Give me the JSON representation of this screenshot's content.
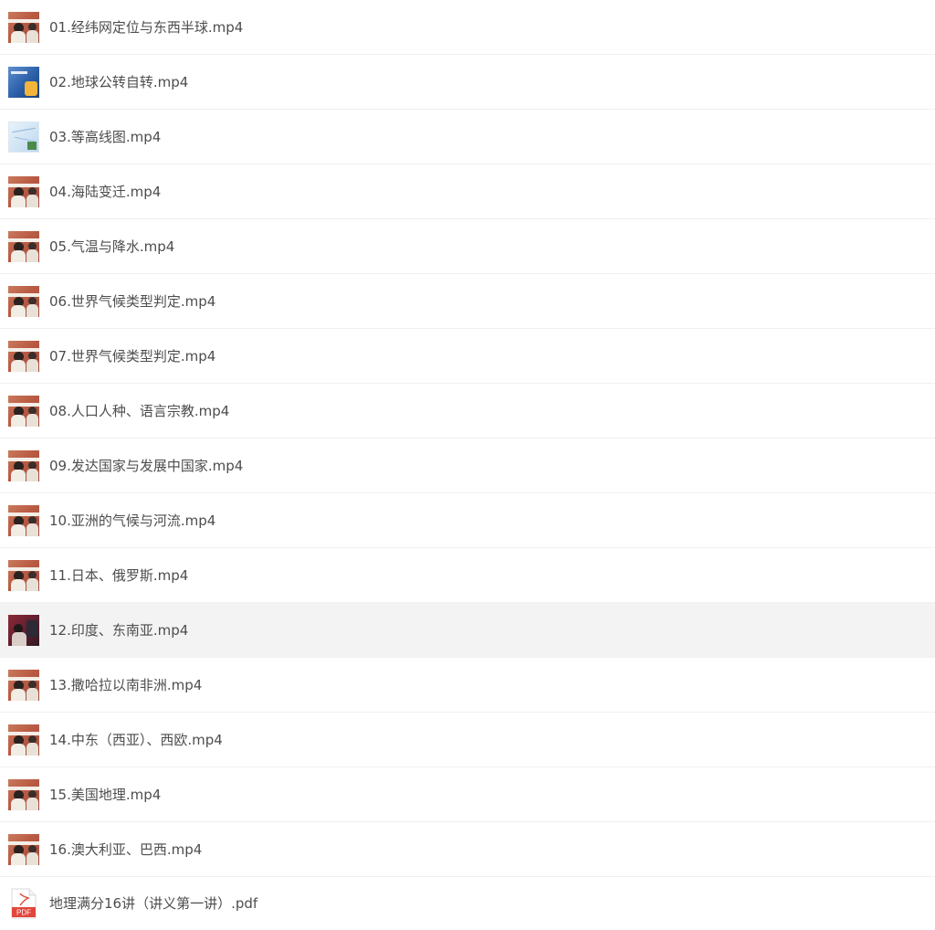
{
  "files": [
    {
      "name": "01.经纬网定位与东西半球.mp4",
      "type": "video"
    },
    {
      "name": "02.地球公转自转.mp4",
      "type": "cover"
    },
    {
      "name": "03.等高线图.mp4",
      "type": "map"
    },
    {
      "name": "04.海陆变迁.mp4",
      "type": "video"
    },
    {
      "name": "05.气温与降水.mp4",
      "type": "video"
    },
    {
      "name": "06.世界气候类型判定.mp4",
      "type": "video"
    },
    {
      "name": "07.世界气候类型判定.mp4",
      "type": "video"
    },
    {
      "name": "08.人口人种、语言宗教.mp4",
      "type": "video"
    },
    {
      "name": "09.发达国家与发展中国家.mp4",
      "type": "video"
    },
    {
      "name": "10.亚洲的气候与河流.mp4",
      "type": "video"
    },
    {
      "name": "11.日本、俄罗斯.mp4",
      "type": "video"
    },
    {
      "name": "12.印度、东南亚.mp4",
      "type": "lecture",
      "selected": true
    },
    {
      "name": "13.撒哈拉以南非洲.mp4",
      "type": "video"
    },
    {
      "name": "14.中东（西亚）、西欧.mp4",
      "type": "video"
    },
    {
      "name": "15.美国地理.mp4",
      "type": "video"
    },
    {
      "name": "16.澳大利亚、巴西.mp4",
      "type": "video"
    },
    {
      "name": "地理满分16讲（讲义第一讲）.pdf",
      "type": "pdf"
    }
  ],
  "icons": {
    "video": "video-thumbnail",
    "cover": "video-thumbnail",
    "map": "video-thumbnail",
    "lecture": "video-thumbnail",
    "pdf": "pdf-file-icon"
  },
  "colors": {
    "selected_row_bg": "#f3f3f3",
    "text": "#4d4d4d",
    "pdf_red": "#e0463b"
  }
}
